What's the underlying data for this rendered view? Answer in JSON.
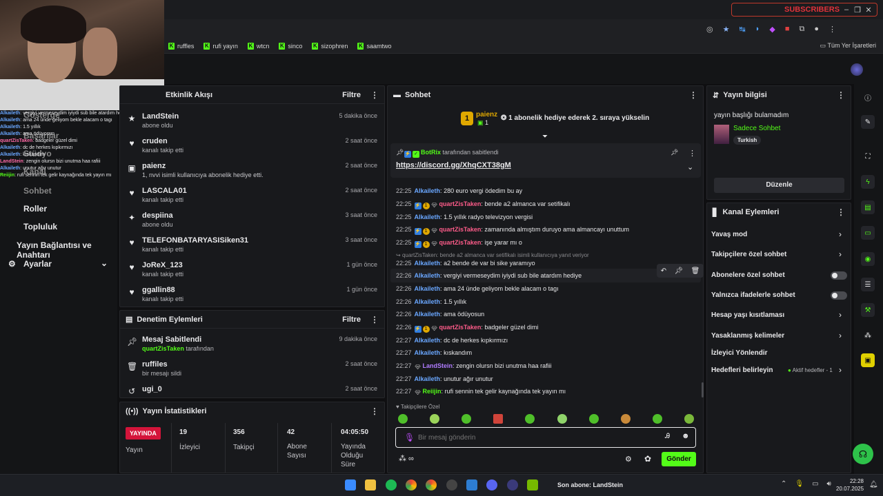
{
  "browser": {
    "window_banner": "SUBSCRIBERS",
    "bookmarks": [
      "ruffles",
      "rufi yayın",
      "wtcn",
      "sinco",
      "sizophren",
      "saamtwo"
    ],
    "all_bookmarks": "Tüm Yer İşaretleri"
  },
  "overlay_chat": [
    {
      "user": "Alkaileth",
      "msg": "vergiyi vermeseydim iyiydi sub bile atardım hediye",
      "style": "u"
    },
    {
      "user": "Alkaileth",
      "msg": "ama 24 ünde geliyom bekle alacam o tagı",
      "style": "u"
    },
    {
      "user": "Alkaileth",
      "msg": "1.5 yıllık",
      "style": "u"
    },
    {
      "user": "Alkaileth",
      "msg": "ama ödüyosun",
      "style": "u"
    },
    {
      "user": "quartZisTaken",
      "msg": "badgeler güzel dimi",
      "style": "p"
    },
    {
      "user": "Alkaileth",
      "msg": "dc de herkes kıpkırmızı",
      "style": "u"
    },
    {
      "user": "Alkaileth",
      "msg": "kıskandım",
      "style": "u"
    },
    {
      "user": "LandStein",
      "msg": "zengin olursn bizi unutma haa rafiii",
      "style": "p"
    },
    {
      "user": "Alkaileth",
      "msg": "unutur ağır unutur",
      "style": "u"
    },
    {
      "user": "Reiijin",
      "msg": "rufi sennin tek gelir kaynağında tek yayın mı",
      "style": "g"
    }
  ],
  "sidenav": {
    "items": [
      "Gösterge",
      "Başarılar",
      "Stüdyo",
      "Kanal",
      "Sohbet",
      "Roller",
      "Topluluk",
      "Yayın Bağlantısı ve Anahtarı",
      "Ayarlar"
    ]
  },
  "activity": {
    "title": "Etkinlik Akışı",
    "filter": "Filtre",
    "items": [
      {
        "name": "LandStein",
        "sub": "abone oldu",
        "time": "5 dakika önce",
        "icon": "star-icon"
      },
      {
        "name": "cruden",
        "sub": "kanalı takip etti",
        "time": "2 saat önce",
        "icon": "heart-icon"
      },
      {
        "name": "paienz",
        "sub": "1, nvvi isimli kullanıcıya abonelik hediye etti.",
        "time": "2 saat önce",
        "icon": "gift-icon"
      },
      {
        "name": "LASCALA01",
        "sub": "kanalı takip etti",
        "time": "2 saat önce",
        "icon": "heart-icon"
      },
      {
        "name": "despiina",
        "sub": "abone oldu",
        "time": "3 saat önce",
        "icon": "sparkle-icon"
      },
      {
        "name": "TELEFONBATARYASISiken31",
        "sub": "kanalı takip etti",
        "time": "3 saat önce",
        "icon": "heart-icon"
      },
      {
        "name": "JoReX_123",
        "sub": "kanalı takip etti",
        "time": "1 gün önce",
        "icon": "heart-icon"
      },
      {
        "name": "ggallin88",
        "sub": "kanalı takip etti",
        "time": "1 gün önce",
        "icon": "heart-icon"
      }
    ]
  },
  "moderation": {
    "title": "Denetim Eylemleri",
    "filter": "Filtre",
    "items": [
      {
        "name": "Mesaj Sabitlendi",
        "sub_user": "quartZisTaken",
        "sub": "tarafından",
        "time": "9 dakika önce",
        "icon": "pin-icon"
      },
      {
        "name": "ruffiles",
        "sub_user": "",
        "sub": "bir mesajı sildi",
        "time": "2 saat önce",
        "icon": "trash-icon"
      },
      {
        "name": "ugi_0",
        "sub_user": "",
        "sub": "",
        "time": "2 saat önce",
        "icon": "undo-icon"
      }
    ]
  },
  "stats": {
    "title": "Yayın İstatistikleri",
    "live": "YAYINDA",
    "live_label": "Yayın",
    "cells": [
      {
        "value": "19",
        "label": "İzleyici"
      },
      {
        "value": "356",
        "label": "Takipçi"
      },
      {
        "value": "42",
        "label": "Abone Sayısı"
      },
      {
        "value": "04:05:50",
        "label": "Yayında Olduğu Süre"
      }
    ]
  },
  "chat": {
    "title": "Sohbet",
    "gifter_name": "paienz",
    "gifter_rank": "1",
    "gifter_count": "1",
    "gifter_msg": "1 abonelik hediye ederek 2. sıraya yükselin",
    "pinned_user": "BotRix",
    "pinned_by": "tarafından sabitlendi",
    "pinned_link": "https://discord.gg/XhqCXT38gM",
    "messages": [
      {
        "time": "22:25",
        "user": "Alkaileth",
        "msg": "280 euro vergi ödedim bu ay",
        "style": "u",
        "badges": []
      },
      {
        "time": "22:25",
        "user": "quartZisTaken",
        "msg": "bende a2 almanca var setifikalı",
        "style": "p",
        "badges": [
          "b-blue",
          "b-gold",
          "b-gem"
        ]
      },
      {
        "time": "22:25",
        "user": "Alkaileth",
        "msg": "1.5 yıllık radyo televizyon vergisi",
        "style": "u",
        "badges": []
      },
      {
        "time": "22:25",
        "user": "quartZisTaken",
        "msg": "zamanında almıştım duruyo ama almancayı unuttum",
        "style": "p",
        "badges": [
          "b-blue",
          "b-gold",
          "b-gem"
        ]
      },
      {
        "time": "22:25",
        "user": "quartZisTaken",
        "msg": "işe yarar mı o",
        "style": "p",
        "badges": [
          "b-blue",
          "b-gold",
          "b-gem"
        ]
      },
      {
        "time": "22:25",
        "user": "Alkaileth",
        "msg": "a2 bende de var bi sike yaramıyo",
        "style": "u",
        "badges": []
      },
      {
        "time": "22:26",
        "user": "Alkaileth",
        "msg": "vergiyi vermeseydim iyiydi sub bile atardım hediye",
        "style": "u",
        "badges": []
      },
      {
        "time": "22:26",
        "user": "Alkaileth",
        "msg": "ama 24 ünde geliyom bekle alacam o tagı",
        "style": "u",
        "badges": []
      },
      {
        "time": "22:26",
        "user": "Alkaileth",
        "msg": "1.5 yıllık",
        "style": "u",
        "badges": []
      },
      {
        "time": "22:26",
        "user": "Alkaileth",
        "msg": "ama ödüyosun",
        "style": "u",
        "badges": []
      },
      {
        "time": "22:26",
        "user": "quartZisTaken",
        "msg": "badgeler güzel dimi",
        "style": "p",
        "badges": [
          "b-blue",
          "b-gold",
          "b-gem"
        ]
      },
      {
        "time": "22:27",
        "user": "Alkaileth",
        "msg": "dc de herkes kıpkırmızı",
        "style": "u",
        "badges": []
      },
      {
        "time": "22:27",
        "user": "Alkaileth",
        "msg": "kıskandım",
        "style": "u",
        "badges": []
      },
      {
        "time": "22:27",
        "user": "LandStein",
        "msg": "zengin olursn bizi unutma haa rafiii",
        "style": "v",
        "badges": [
          "b-gem"
        ]
      },
      {
        "time": "22:27",
        "user": "Alkaileth",
        "msg": "unutur ağır unutur",
        "style": "u",
        "badges": []
      },
      {
        "time": "22:27",
        "user": "Reiijin",
        "msg": "rufi sennin tek gelir kaynağında tek yayın mı",
        "style": "g",
        "badges": [
          "b-gem"
        ]
      }
    ],
    "reply_hint": "quartZisTaken: bende a2 almanca var setifikalı isimli kullanıcıya yanıt veriyor",
    "followers_only": "Takipçilere Özel",
    "input_placeholder": "Bir mesaj gönderin",
    "send": "Gönder"
  },
  "stream_info": {
    "title": "Yayın bilgisi",
    "stream_title": "yayın başlığı bulamadım",
    "category": "Sadece Sohbet",
    "language": "Turkish",
    "edit": "Düzenle"
  },
  "channel_actions": {
    "title": "Kanal Eylemleri",
    "items": [
      {
        "label": "Yavaş mod",
        "kind": "chevron"
      },
      {
        "label": "Takipçilere özel sohbet",
        "kind": "chevron"
      },
      {
        "label": "Abonelere özel sohbet",
        "kind": "toggle"
      },
      {
        "label": "Yalnızca ifadelerle sohbet",
        "kind": "toggle"
      },
      {
        "label": "Hesap yaşı kısıtlaması",
        "kind": "chevron"
      },
      {
        "label": "Yasaklanmış kelimeler",
        "kind": "chevron"
      },
      {
        "label": "İzleyici Yönlendir",
        "kind": "none"
      },
      {
        "label": "Hedefleri belirleyin",
        "kind": "chevron"
      }
    ],
    "goals_status": "Aktif hedefler - 1"
  },
  "taskbar": {
    "now_playing": "Son abone: LandStein",
    "time": "22:28",
    "date": "20.07.2025"
  },
  "colors": {
    "accent": "#53fc18",
    "link_user": "#6aa7ff",
    "pink_user": "#ff5c8a"
  }
}
